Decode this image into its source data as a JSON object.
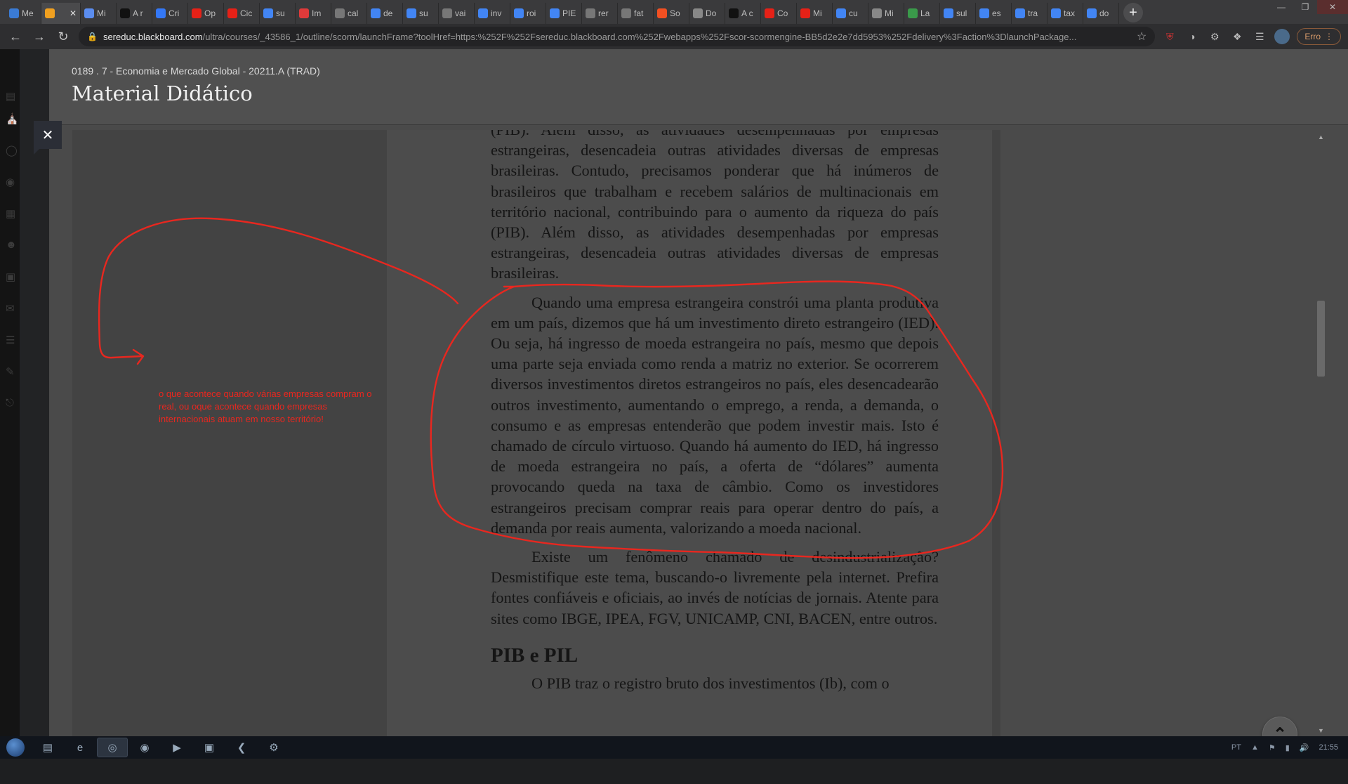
{
  "browser": {
    "tabs": [
      {
        "label": "Me",
        "icon": "edge-icon",
        "color": "#3a7bd5"
      },
      {
        "label": "",
        "icon": "blackboard-icon",
        "color": "#f0a020",
        "active": true
      },
      {
        "label": "Mi",
        "icon": "globe-icon",
        "color": "#5b8def"
      },
      {
        "label": "A r",
        "icon": "brainly-icon",
        "color": "#111111"
      },
      {
        "label": "Cri",
        "icon": "check-icon",
        "color": "#3478f6"
      },
      {
        "label": "Op",
        "icon": "youtube-icon",
        "color": "#e62117"
      },
      {
        "label": "Cic",
        "icon": "youtube-icon",
        "color": "#e62117"
      },
      {
        "label": "su",
        "icon": "google-icon",
        "color": "#4285f4"
      },
      {
        "label": "Im",
        "icon": "infinity-icon",
        "color": "#e03a3a"
      },
      {
        "label": "cal",
        "icon": "mail-icon",
        "color": "#777777"
      },
      {
        "label": "de",
        "icon": "google-icon",
        "color": "#4285f4"
      },
      {
        "label": "su",
        "icon": "google-icon",
        "color": "#4285f4"
      },
      {
        "label": "vai",
        "icon": "mail-icon",
        "color": "#777777"
      },
      {
        "label": "inv",
        "icon": "google-icon",
        "color": "#4285f4"
      },
      {
        "label": "roi",
        "icon": "google-icon",
        "color": "#4285f4"
      },
      {
        "label": "PIE",
        "icon": "google-icon",
        "color": "#4285f4"
      },
      {
        "label": "rer",
        "icon": "mail-icon",
        "color": "#777777"
      },
      {
        "label": "fat",
        "icon": "mail-icon",
        "color": "#777777"
      },
      {
        "label": "So",
        "icon": "microsoft-icon",
        "color": "#f25022"
      },
      {
        "label": "Do",
        "icon": "globe-icon",
        "color": "#888888"
      },
      {
        "label": "A c",
        "icon": "brainly-icon",
        "color": "#111111"
      },
      {
        "label": "Co",
        "icon": "youtube-icon",
        "color": "#e62117"
      },
      {
        "label": "Mi",
        "icon": "youtube-icon",
        "color": "#e62117"
      },
      {
        "label": "cu",
        "icon": "google-icon",
        "color": "#4285f4"
      },
      {
        "label": "Mi",
        "icon": "globe-icon",
        "color": "#888888"
      },
      {
        "label": "La",
        "icon": "leaf-icon",
        "color": "#3a9a4a"
      },
      {
        "label": "sul",
        "icon": "google-icon",
        "color": "#4285f4"
      },
      {
        "label": "es",
        "icon": "google-icon",
        "color": "#4285f4"
      },
      {
        "label": "tra",
        "icon": "google-icon",
        "color": "#4285f4"
      },
      {
        "label": "tax",
        "icon": "google-icon",
        "color": "#4285f4"
      },
      {
        "label": "do",
        "icon": "google-icon",
        "color": "#4285f4"
      }
    ],
    "url_host": "sereduc.blackboard.com",
    "url_path": "/ultra/courses/_43586_1/outline/scorm/launchFrame?toolHref=https:%252F%252Fsereduc.blackboard.com%252Fwebapps%252Fscor-scormengine-BB5d2e2e7dd5953%252Fdelivery%3Faction%3DlaunchPackage...",
    "error_label": "Erro"
  },
  "course": {
    "breadcrumb": "0189 . 7 - Economia e Mercado Global - 20211.A (TRAD)",
    "title": "Material Didático"
  },
  "document": {
    "p0": "(PIB). Além disso, as atividades desempenhadas por empresas estrangeiras, desencadeia outras atividades diversas de empresas brasileiras. Contudo, precisamos ponderar que há inúmeros de brasileiros que trabalham e recebem salários de multinacionais em território nacional, contribuindo para o aumento da riqueza do país (PIB). Além disso, as atividades desempenhadas por empresas estrangeiras, desencadeia outras atividades diversas de empresas brasileiras.",
    "p1": "Quando uma empresa estrangeira constrói uma planta produtiva em um país, dizemos que há um investimento direto estrangeiro (IED). Ou seja, há ingresso de moeda estrangeira no país, mesmo que depois uma parte seja enviada como renda a matriz no exterior. Se ocorrerem diversos investimentos diretos estrangeiros no país, eles desencadearão outros investimento, aumentando o emprego, a renda, a demanda, o consumo e as empresas entenderão que podem investir mais. Isto é chamado de círculo virtuoso. Quando há aumento do IED, há ingresso de moeda estrangeira no país, a oferta de “dólares” aumenta provocando queda na taxa de câmbio. Como os investidores estrangeiros precisam comprar reais para operar dentro do país, a demanda por reais aumenta, valorizando a moeda nacional.",
    "p2": "Existe um fenômeno chamado de desindustrialização? Desmistifique este tema, buscando-o livremente pela internet. Prefira fontes confiáveis e oficiais, ao invés de notícias de jornais. Atente para sites como IBGE, IPEA, FGV, UNICAMP, CNI, BACEN, entre outros.",
    "heading": "PIB e PIL",
    "p3": "O PIB traz o registro bruto dos investimentos (Ib), com o"
  },
  "annotation": {
    "note": "o que acontece quando várias empresas compram o real, ou oque acontece quando empresas internacionais atuam em nosso território!",
    "color": "#e8271f"
  },
  "taskbar": {
    "apps": [
      "explorer-icon",
      "ie-icon",
      "chrome-icon",
      "record-icon",
      "media-player-icon",
      "window-icon",
      "vscode-icon",
      "game-icon"
    ],
    "language": "PT",
    "time": "21:55"
  }
}
